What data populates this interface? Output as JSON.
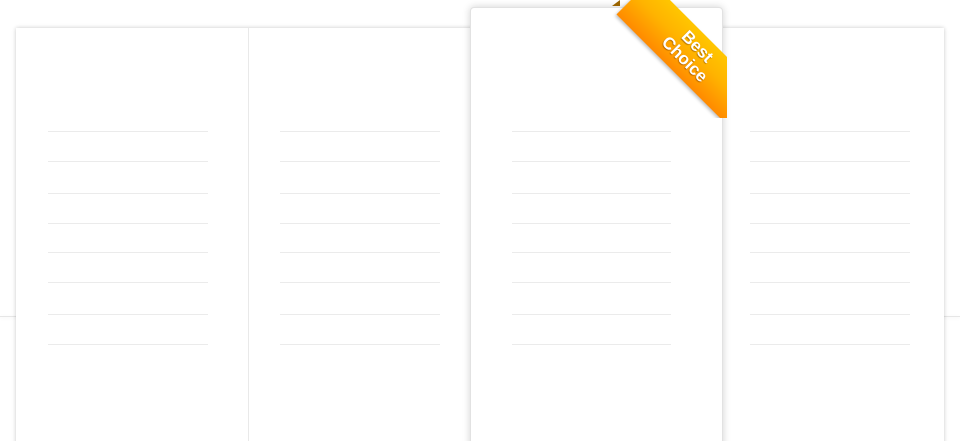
{
  "ribbon": {
    "line1": "Best",
    "line2": "Choice",
    "color_top": "#ffc600",
    "color_bottom": "#ff8a00"
  },
  "columns": [
    {
      "id": "plan-1",
      "featured": false,
      "rows": [
        "",
        "",
        "",
        "",
        "",
        "",
        "",
        ""
      ]
    },
    {
      "id": "plan-2",
      "featured": false,
      "rows": [
        "",
        "",
        "",
        "",
        "",
        "",
        "",
        ""
      ]
    },
    {
      "id": "plan-3",
      "featured": true,
      "rows": [
        "",
        "",
        "",
        "",
        "",
        "",
        "",
        ""
      ]
    },
    {
      "id": "plan-4",
      "featured": false,
      "rows": [
        "",
        "",
        "",
        "",
        "",
        "",
        "",
        ""
      ]
    }
  ],
  "colors": {
    "background": "#ffffff",
    "divider": "#ebebeb",
    "ribbon_text": "#ffffff"
  }
}
